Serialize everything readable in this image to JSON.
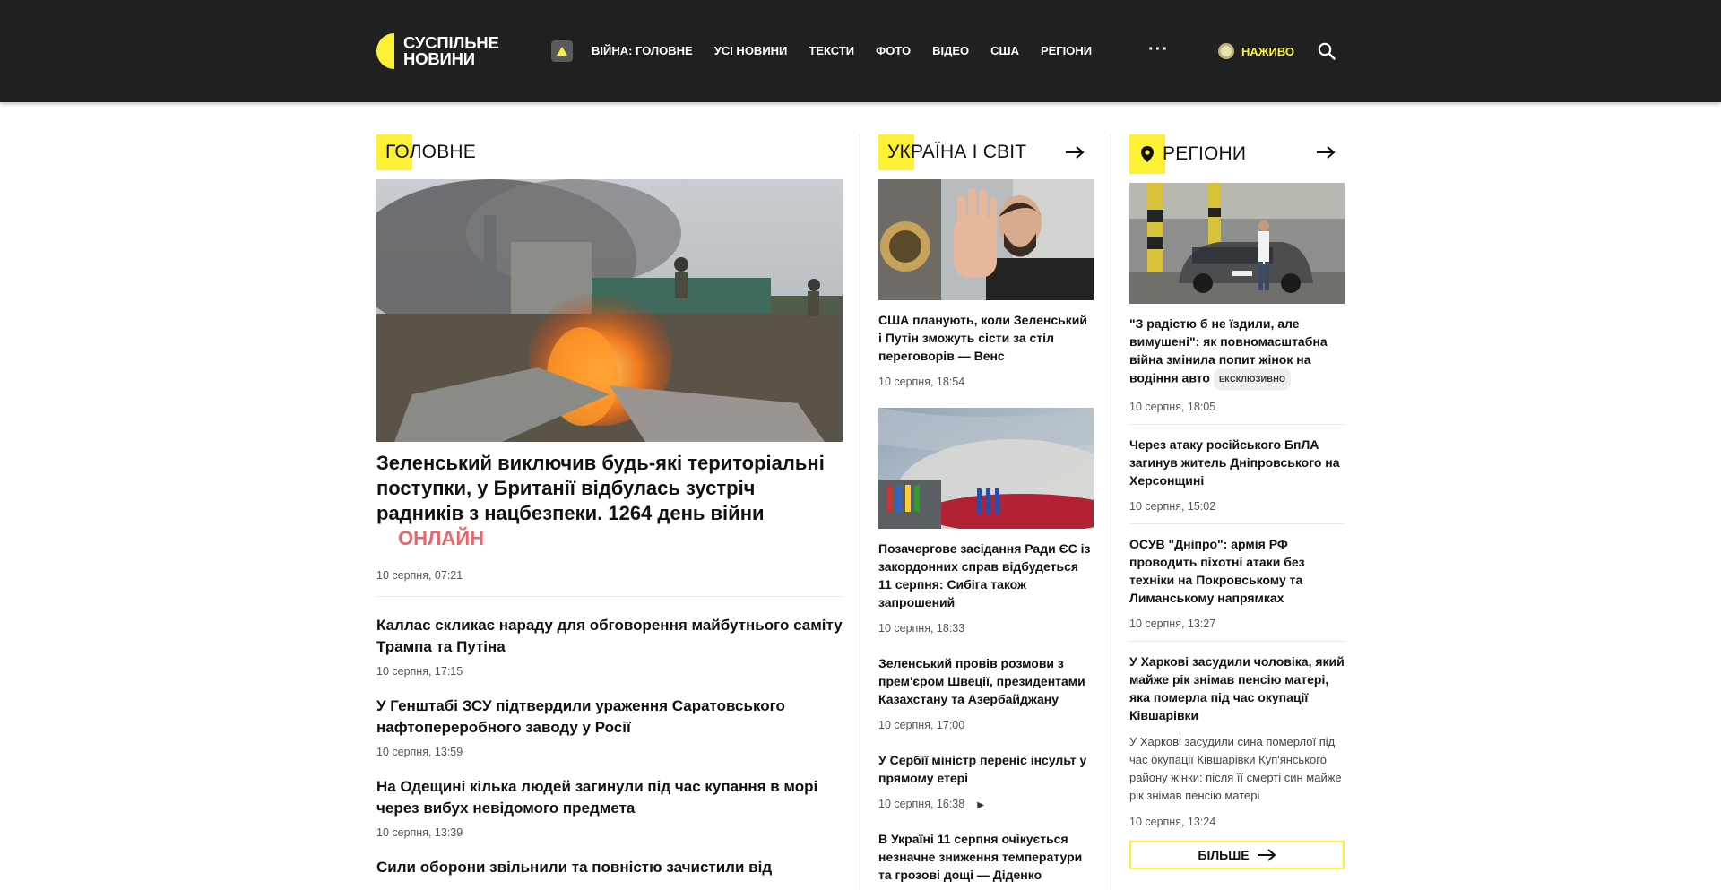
{
  "header": {
    "logo": {
      "line1": "СУСПІЛЬНЕ",
      "line2": "НОВИНИ"
    },
    "nav": [
      "ВІЙНА: ГОЛОВНЕ",
      "УСІ НОВИНИ",
      "ТЕКСТИ",
      "ФОТО",
      "ВІДЕО",
      "США",
      "РЕГІОНИ"
    ],
    "more": "···",
    "live": "НАЖИВО",
    "icons": [
      "war-badge-icon",
      "search-icon"
    ],
    "accent": "#fef035",
    "bg": "#202020"
  },
  "main": {
    "title": "ГОЛОВНЕ",
    "lead": {
      "headline": "Зеленський виключив будь-які територіальні поступки, у Британії відбулась зустріч радників з нацбезпеки. 1264 день війни",
      "badge": "ОНЛАЙН",
      "date": "10 серпня, 07:21"
    },
    "items": [
      {
        "title": "Каллас скликає нараду для обговорення майбутнього саміту Трампа та Путіна",
        "date": "10 серпня, 17:15"
      },
      {
        "title": "У Генштабі ЗСУ підтвердили ураження Саратовського нафтопереробного заводу у Росії",
        "date": "10 серпня, 13:59"
      },
      {
        "title": "На Одещині кілька людей загинули під час купання в морі через вибух невідомого предмета",
        "date": "10 серпня, 13:39"
      },
      {
        "title": "Сили оборони звільнили та повністю зачистили від",
        "date": ""
      }
    ]
  },
  "world": {
    "title": "УКРАЇНА І СВІТ",
    "items": [
      {
        "title": "США планують, коли Зеленський і Путін зможуть сісти за стіл переговорів — Венс",
        "date": "10 серпня, 18:54"
      },
      {
        "title": "Позачергове засідання Ради ЄС із закордонних справ відбудеться 11 серпня: Сибіга також запрошений",
        "date": "10 серпня, 18:33"
      },
      {
        "title": "Зеленський провів розмови з прем'єром Швеції, президентами Казахстану та Азербайджану",
        "date": "10 серпня, 17:00"
      },
      {
        "title": "У Сербії міністр переніс інсульт у прямому етері",
        "date": "10 серпня, 16:38",
        "icon": "play-icon"
      },
      {
        "title": "В Україні 11 серпня очікується незначне зниження температури та грозові дощі — Діденко",
        "date": ""
      }
    ]
  },
  "regions": {
    "title": "РЕГІОНИ",
    "items": [
      {
        "title": "\"З радістю б не їздили, але вимушені\": як повномасштабна війна змінила попит жінок на водіння авто",
        "tag": "ЕКСКЛЮЗИВНО",
        "date": "10 серпня, 18:05"
      },
      {
        "title": "Через атаку російського БпЛА загинув житель Дніпровського на Херсонщині",
        "date": "10 серпня, 15:02"
      },
      {
        "title": "ОСУВ \"Дніпро\": армія РФ проводить піхотні атаки без техніки на Покровському та Лиманському напрямках",
        "date": "10 серпня, 13:27"
      },
      {
        "title": "У Харкові засудили чоловіка, який майже рік знімав пенсію матері, яка померла під час окупації Ківшарівки",
        "desc": "У Харкові засудили сина померлої під час окупації Ківшарівки Куп'янського району жінки: після її смерті син майже рік знімав пенсію матері",
        "date": "10 серпня, 13:24"
      }
    ],
    "more": "БІЛЬШЕ"
  }
}
